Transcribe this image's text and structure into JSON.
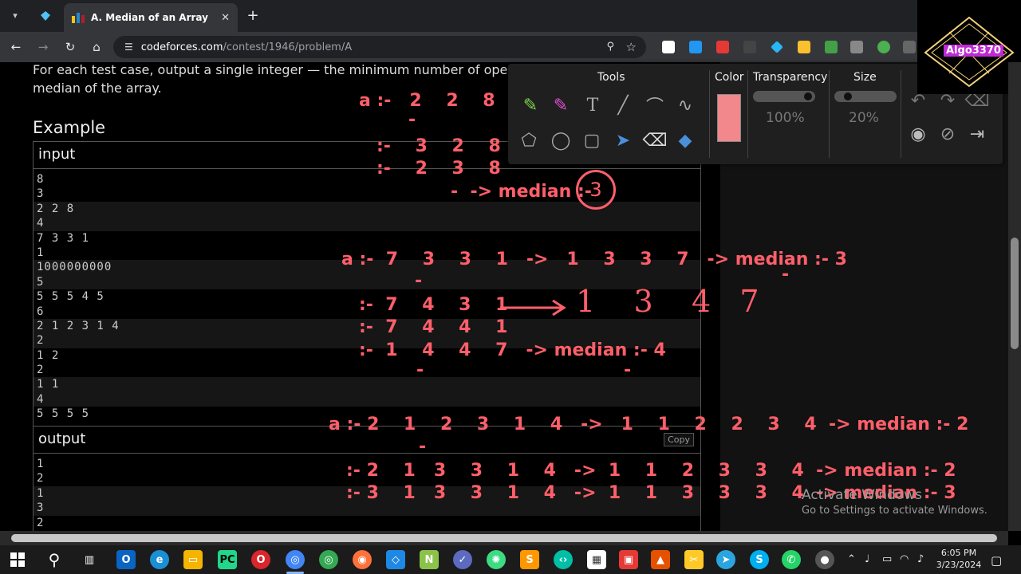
{
  "browser": {
    "tab_title": "A. Median of an Array",
    "tab_close": "✕",
    "new_tab": "+",
    "url_host": "codeforces.com",
    "url_path": "/contest/1946/problem/A"
  },
  "problem": {
    "output_desc_1": "For each test case, output a single integer — the minimum number of operations",
    "output_desc_2": "median of the array.",
    "example_heading": "Example",
    "input_label": "input",
    "output_label": "output",
    "copy_label": "Copy",
    "input_lines": [
      "8",
      "3",
      "2 2 8",
      "4",
      "7 3 3 1",
      "1",
      "1000000000",
      "5",
      "5 5 5 4 5",
      "6",
      "2 1 2 3 1 4",
      "2",
      "1 2",
      "2",
      "1 1",
      "4",
      "5 5 5 5"
    ],
    "output_lines": [
      "1",
      "2",
      "1",
      "3",
      "2"
    ]
  },
  "annotations": {
    "a1": "a :-   2    2    8",
    "a1b": ":-    3    2    8",
    "a1c": ":-    2    3    8",
    "a1d": "-  -> median :-",
    "a1circle": "3",
    "b1": "a :-  7    3    3    1   ->   1    3    3    7   -> median :- 3",
    "b2": ":-  7    4    3    1",
    "b3": ":-  7    4    4    1",
    "b4": ":-  1    4    4    7   -> median :- 4",
    "bhand": "1    3    4   7",
    "c1": "a :- 2    1    2    3    1    4   ->   1    1    2    2    3    4  -> median :- 2",
    "c2": ":- 2    1   3    3    1    4   ->  1    1    2    3    3    4  -> median :- 2",
    "c3": ":- 3    1   3    3    1    4   ->  1    1    3    3    3    4  -> median :- 3"
  },
  "palette": {
    "tools_label": "Tools",
    "color_label": "Color",
    "color_value": "#f2878c",
    "transparency_label": "Transparency",
    "transparency_value": "100%",
    "size_label": "Size",
    "size_value": "20%"
  },
  "logo": {
    "text": "Algo3370"
  },
  "watermark": {
    "line1": "Activate Windows",
    "line2": "Go to Settings to activate Windows."
  },
  "taskbar": {
    "time": "6:05 PM",
    "date": "3/23/2024"
  }
}
